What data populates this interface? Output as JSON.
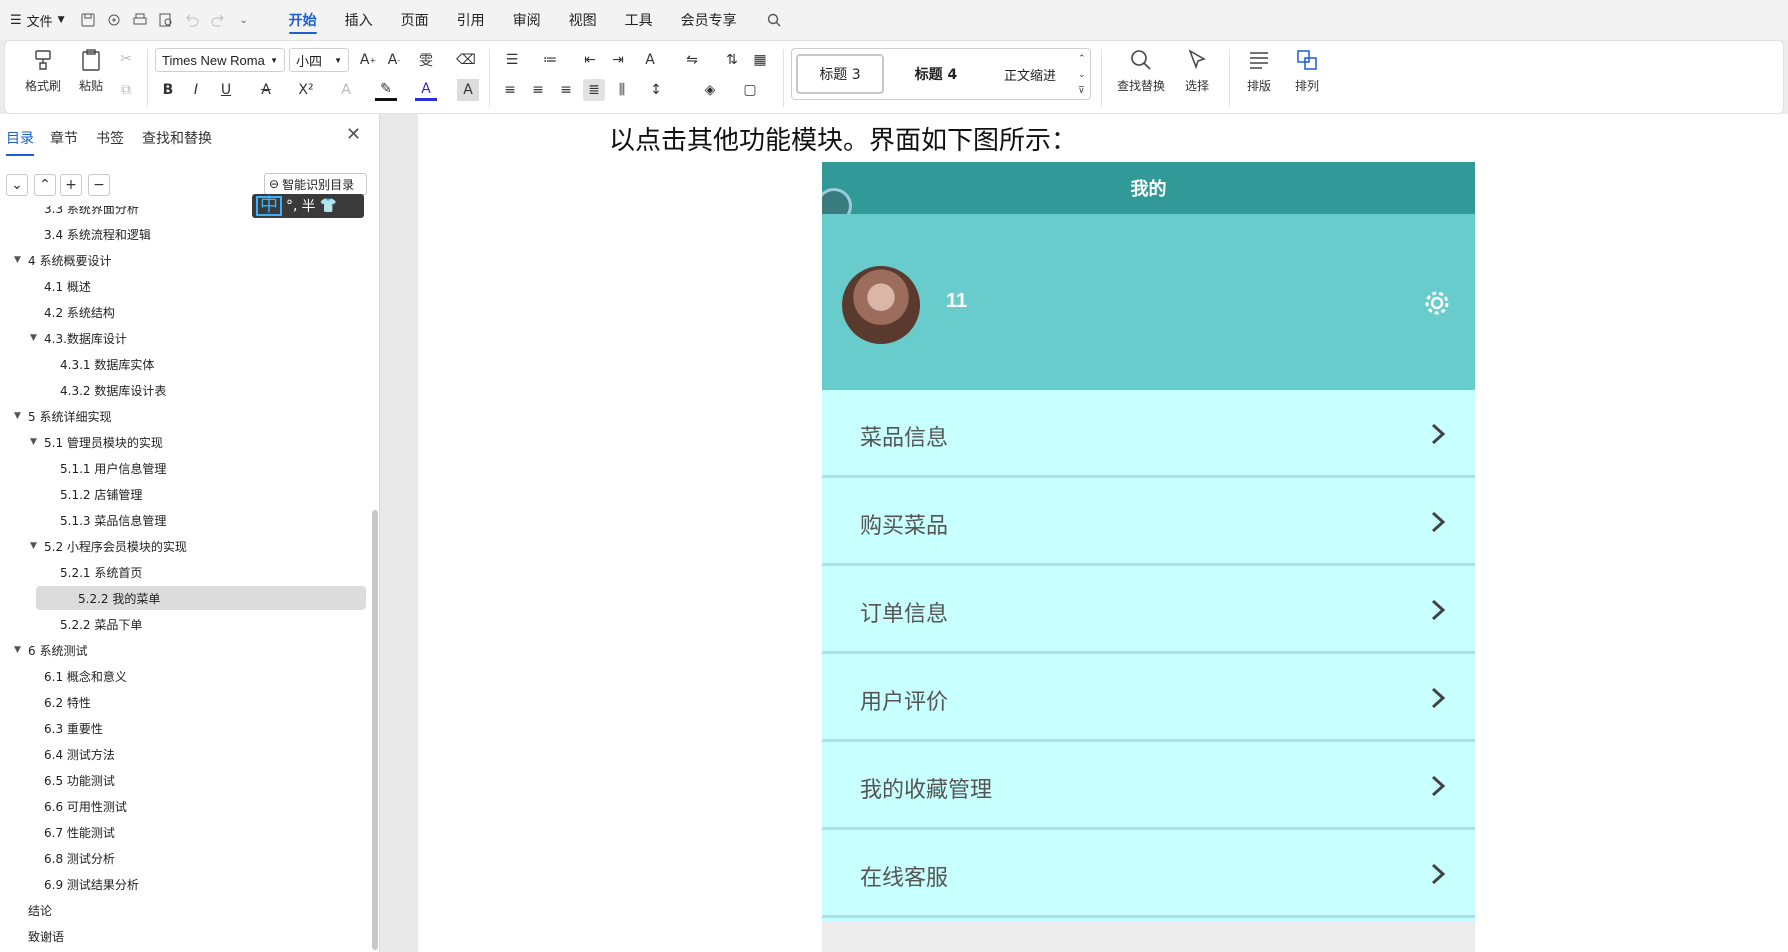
{
  "topbar": {
    "file_label": "文件",
    "tabs": [
      {
        "label": "开始"
      },
      {
        "label": "插入"
      },
      {
        "label": "页面"
      },
      {
        "label": "引用"
      },
      {
        "label": "审阅"
      },
      {
        "label": "视图"
      },
      {
        "label": "工具"
      },
      {
        "label": "会员专享"
      }
    ]
  },
  "ribbon": {
    "format_painter": "格式刷",
    "paste": "粘贴",
    "font_name": "Times New Roma",
    "font_size": "小四",
    "styles": [
      "标题 3",
      "标题 4",
      "正文缩进"
    ],
    "find_replace": "查找替换",
    "select": "选择",
    "layout": "排版",
    "arrange": "排列"
  },
  "nav": {
    "tabs": [
      "目录",
      "章节",
      "书签",
      "查找和替换"
    ],
    "smart_toc": "智能识别目录",
    "ime": {
      "mode": "中",
      "punct": "°,",
      "width": "半"
    },
    "toc": [
      {
        "label": "3.3 系统界面分析",
        "level": 2,
        "caret": ""
      },
      {
        "label": "3.4 系统流程和逻辑",
        "level": 2,
        "caret": ""
      },
      {
        "label": "4 系统概要设计",
        "level": 1,
        "caret": "▼"
      },
      {
        "label": "4.1 概述",
        "level": 2,
        "caret": ""
      },
      {
        "label": "4.2 系统结构",
        "level": 2,
        "caret": ""
      },
      {
        "label": "4.3.数据库设计",
        "level": 2,
        "caret": "▼"
      },
      {
        "label": "4.3.1 数据库实体",
        "level": 3,
        "caret": ""
      },
      {
        "label": "4.3.2 数据库设计表",
        "level": 3,
        "caret": ""
      },
      {
        "label": "5 系统详细实现",
        "level": 1,
        "caret": "▼"
      },
      {
        "label": "5.1  管理员模块的实现",
        "level": 2,
        "caret": "▼"
      },
      {
        "label": "5.1.1  用户信息管理",
        "level": 3,
        "caret": ""
      },
      {
        "label": "5.1.2  店铺管理",
        "level": 3,
        "caret": ""
      },
      {
        "label": "5.1.3  菜品信息管理",
        "level": 3,
        "caret": ""
      },
      {
        "label": "5.2  小程序会员模块的实现",
        "level": 2,
        "caret": "▼"
      },
      {
        "label": "5.2.1  系统首页",
        "level": 3,
        "caret": ""
      },
      {
        "label": "5.2.2  我的菜单",
        "level": 3,
        "caret": "",
        "active": true
      },
      {
        "label": "5.2.2  菜品下单",
        "level": 3,
        "caret": ""
      },
      {
        "label": "6 系统测试",
        "level": 1,
        "caret": "▼"
      },
      {
        "label": "6.1 概念和意义",
        "level": 2,
        "caret": ""
      },
      {
        "label": "6.2 特性",
        "level": 2,
        "caret": ""
      },
      {
        "label": "6.3 重要性",
        "level": 2,
        "caret": ""
      },
      {
        "label": "6.4 测试方法",
        "level": 2,
        "caret": ""
      },
      {
        "label": "6.5  功能测试",
        "level": 2,
        "caret": ""
      },
      {
        "label": "6.6 可用性测试",
        "level": 2,
        "caret": ""
      },
      {
        "label": "6.7 性能测试",
        "level": 2,
        "caret": ""
      },
      {
        "label": "6.8 测试分析",
        "level": 2,
        "caret": ""
      },
      {
        "label": "6.9 测试结果分析",
        "level": 2,
        "caret": ""
      },
      {
        "label": "结论",
        "level": 1,
        "caret": ""
      },
      {
        "label": "致谢语",
        "level": 1,
        "caret": ""
      }
    ]
  },
  "doc": {
    "text": "以点击其他功能模块。界面如下图所示：",
    "phone": {
      "header": "我的",
      "username": "11",
      "menu": [
        "菜品信息",
        "购买菜品",
        "订单信息",
        "用户评价",
        "我的收藏管理",
        "在线客服"
      ],
      "colors": {
        "header": "#319a99",
        "profile": "#67cccb",
        "row": "#c8ffff"
      }
    }
  }
}
